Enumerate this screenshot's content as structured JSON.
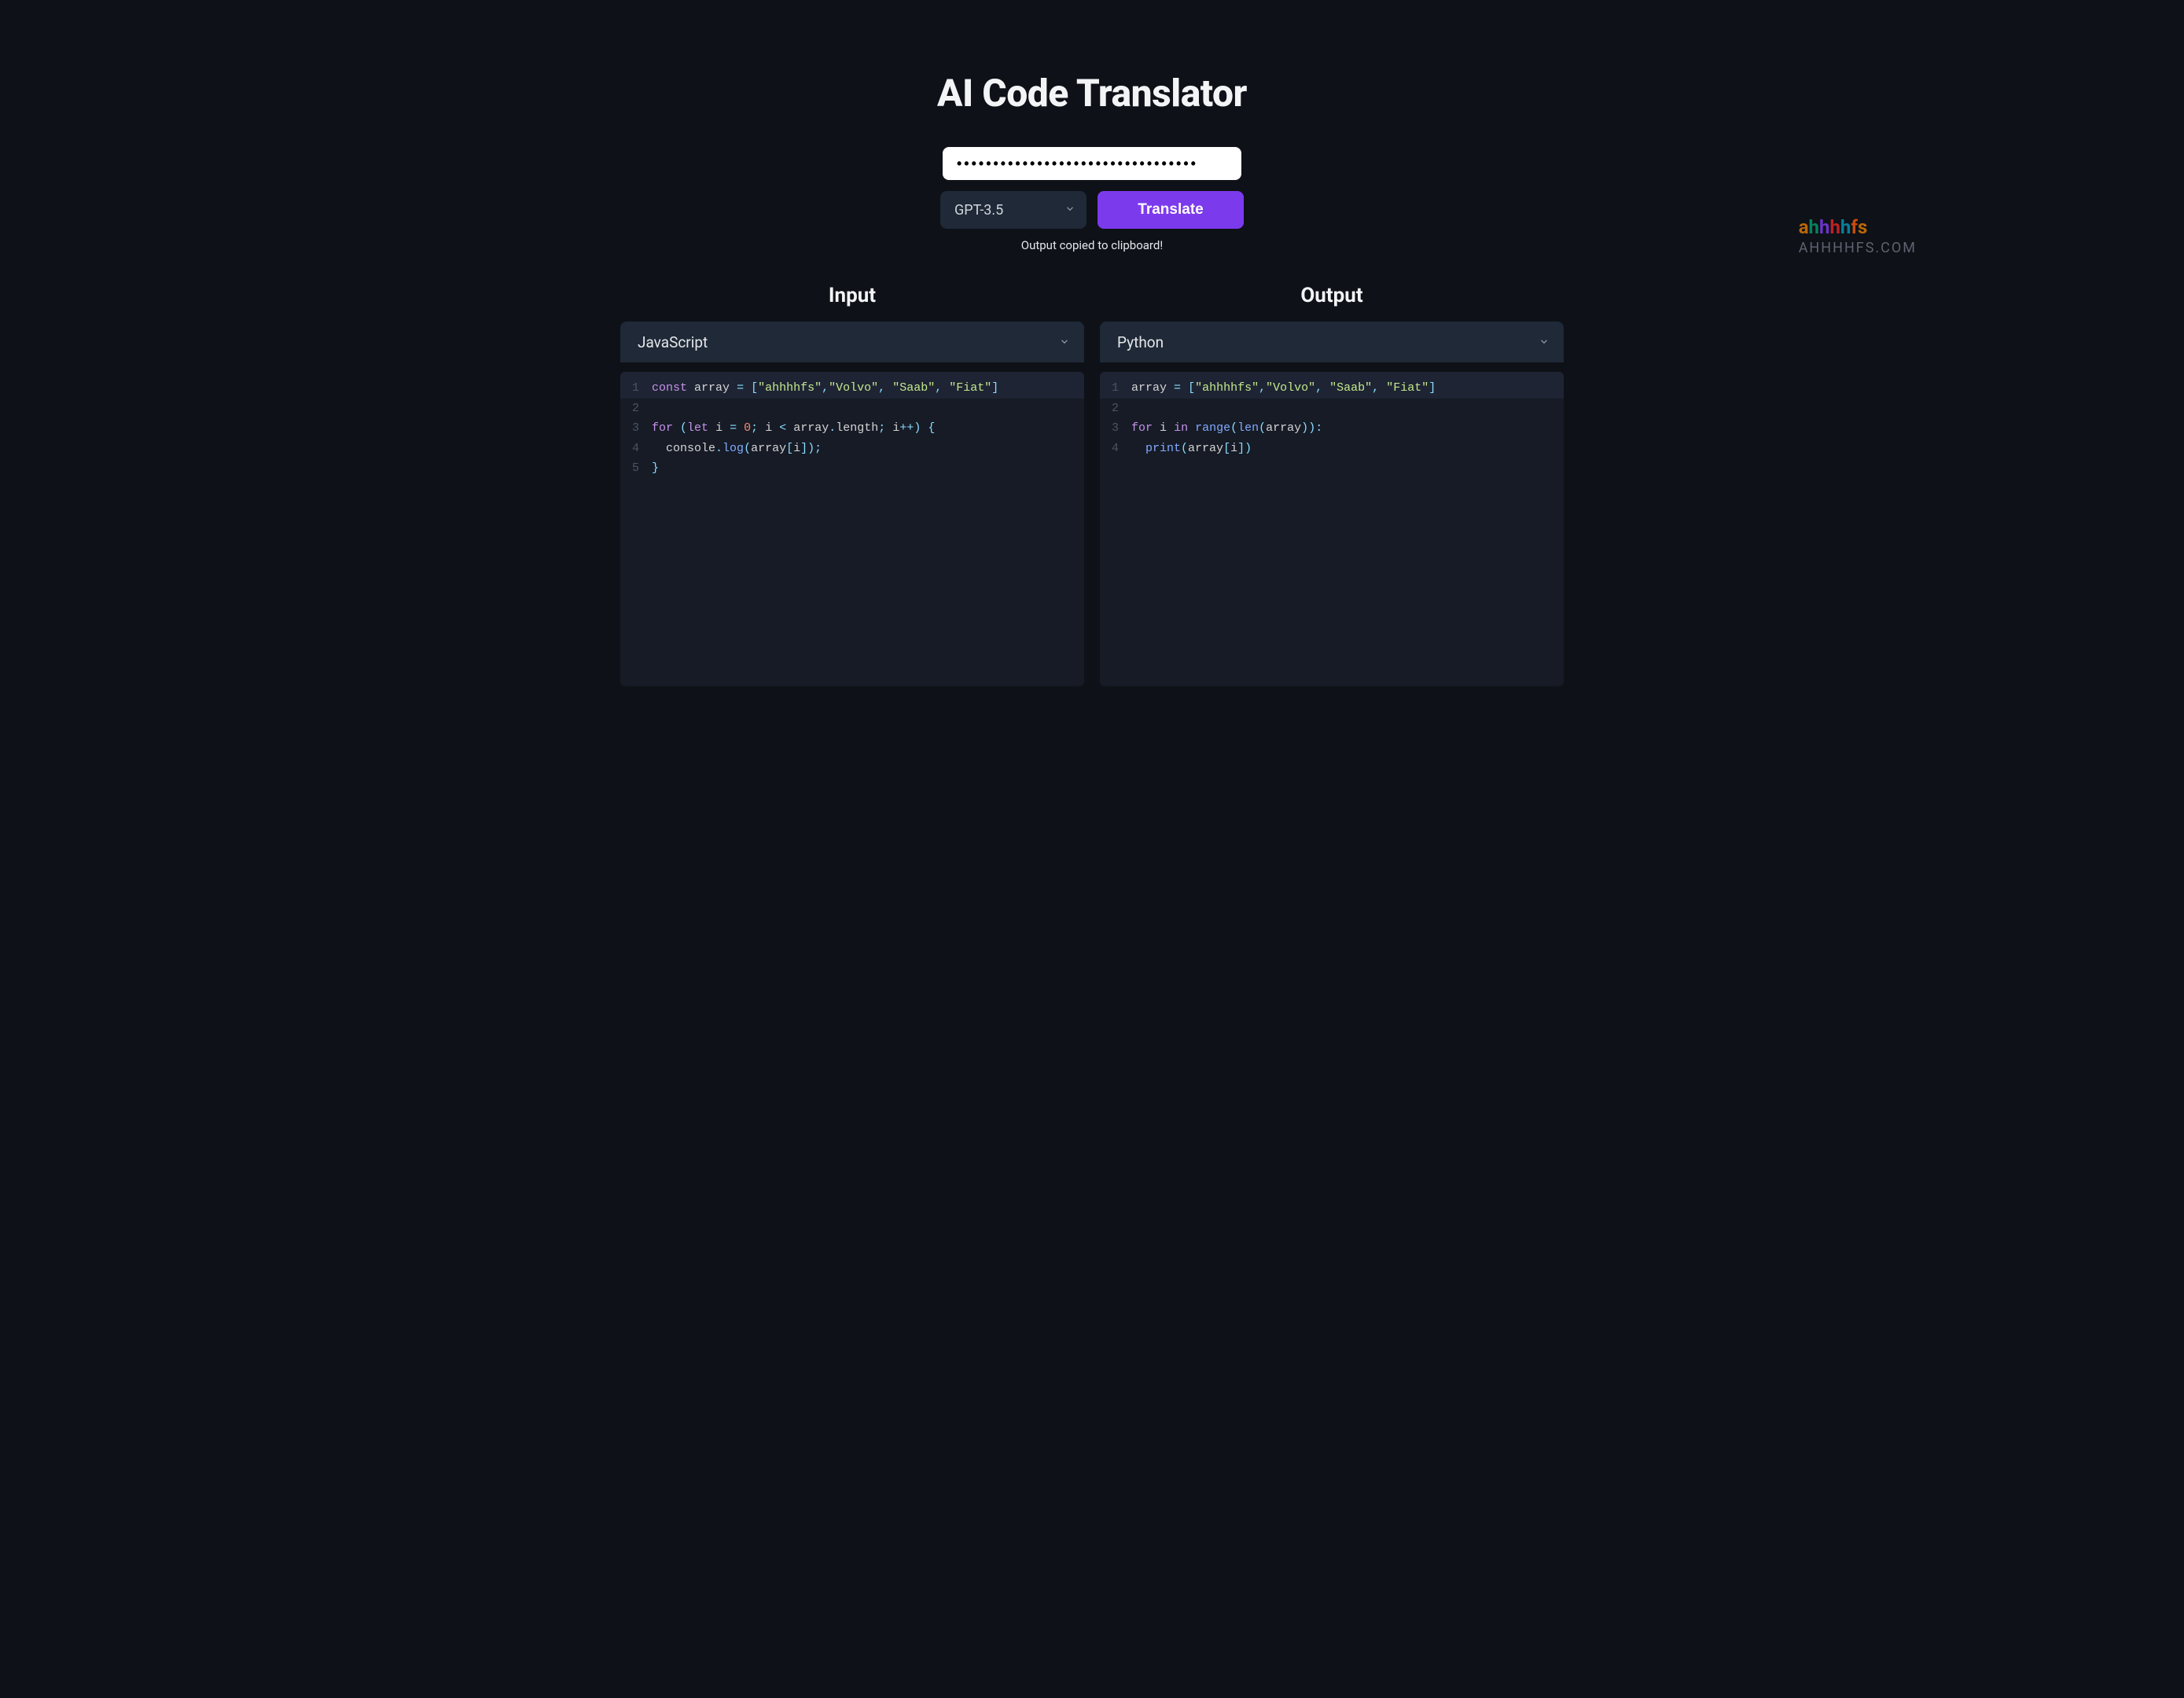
{
  "title": "AI Code Translator",
  "api_key_value": "•••••••••••••••••••••••••••••••••",
  "model_select": {
    "selected": "GPT-3.5"
  },
  "translate_button_label": "Translate",
  "status_message": "Output copied to clipboard!",
  "watermark": {
    "brand": "ahhhhfs",
    "domain": "AHHHHFS.COM"
  },
  "input_panel": {
    "title": "Input",
    "language": "JavaScript",
    "code_lines": [
      {
        "num": "1",
        "highlighted": true,
        "tokens": [
          {
            "t": "const",
            "c": "keyword"
          },
          {
            "t": " ",
            "c": "default"
          },
          {
            "t": "array",
            "c": "default"
          },
          {
            "t": " ",
            "c": "default"
          },
          {
            "t": "=",
            "c": "operator"
          },
          {
            "t": " ",
            "c": "default"
          },
          {
            "t": "[",
            "c": "punct"
          },
          {
            "t": "\"ahhhhfs\"",
            "c": "string"
          },
          {
            "t": ",",
            "c": "punct"
          },
          {
            "t": "\"Volvo\"",
            "c": "string"
          },
          {
            "t": ",",
            "c": "punct"
          },
          {
            "t": " ",
            "c": "default"
          },
          {
            "t": "\"Saab\"",
            "c": "string"
          },
          {
            "t": ",",
            "c": "punct"
          },
          {
            "t": " ",
            "c": "default"
          },
          {
            "t": "\"Fiat\"",
            "c": "string"
          },
          {
            "t": "]",
            "c": "punct"
          }
        ]
      },
      {
        "num": "2",
        "highlighted": false,
        "tokens": []
      },
      {
        "num": "3",
        "highlighted": false,
        "tokens": [
          {
            "t": "for",
            "c": "keyword"
          },
          {
            "t": " ",
            "c": "default"
          },
          {
            "t": "(",
            "c": "punct"
          },
          {
            "t": "let",
            "c": "keyword"
          },
          {
            "t": " ",
            "c": "default"
          },
          {
            "t": "i",
            "c": "default"
          },
          {
            "t": " ",
            "c": "default"
          },
          {
            "t": "=",
            "c": "operator"
          },
          {
            "t": " ",
            "c": "default"
          },
          {
            "t": "0",
            "c": "number"
          },
          {
            "t": ";",
            "c": "punct"
          },
          {
            "t": " ",
            "c": "default"
          },
          {
            "t": "i",
            "c": "default"
          },
          {
            "t": " ",
            "c": "default"
          },
          {
            "t": "<",
            "c": "operator"
          },
          {
            "t": " ",
            "c": "default"
          },
          {
            "t": "array",
            "c": "default"
          },
          {
            "t": ".",
            "c": "punct"
          },
          {
            "t": "length",
            "c": "default"
          },
          {
            "t": ";",
            "c": "punct"
          },
          {
            "t": " ",
            "c": "default"
          },
          {
            "t": "i",
            "c": "default"
          },
          {
            "t": "++",
            "c": "operator"
          },
          {
            "t": ")",
            "c": "punct"
          },
          {
            "t": " ",
            "c": "default"
          },
          {
            "t": "{",
            "c": "punct"
          }
        ]
      },
      {
        "num": "4",
        "highlighted": false,
        "tokens": [
          {
            "t": "  ",
            "c": "default"
          },
          {
            "t": "console",
            "c": "default"
          },
          {
            "t": ".",
            "c": "punct"
          },
          {
            "t": "log",
            "c": "function"
          },
          {
            "t": "(",
            "c": "punct"
          },
          {
            "t": "array",
            "c": "default"
          },
          {
            "t": "[",
            "c": "punct"
          },
          {
            "t": "i",
            "c": "default"
          },
          {
            "t": "]",
            "c": "punct"
          },
          {
            "t": ")",
            "c": "punct"
          },
          {
            "t": ";",
            "c": "punct"
          }
        ]
      },
      {
        "num": "5",
        "highlighted": false,
        "tokens": [
          {
            "t": "}",
            "c": "punct"
          }
        ]
      }
    ]
  },
  "output_panel": {
    "title": "Output",
    "language": "Python",
    "code_lines": [
      {
        "num": "1",
        "highlighted": true,
        "tokens": [
          {
            "t": "array",
            "c": "default"
          },
          {
            "t": " ",
            "c": "default"
          },
          {
            "t": "=",
            "c": "operator"
          },
          {
            "t": " ",
            "c": "default"
          },
          {
            "t": "[",
            "c": "punct"
          },
          {
            "t": "\"ahhhhfs\"",
            "c": "string"
          },
          {
            "t": ",",
            "c": "punct"
          },
          {
            "t": "\"Volvo\"",
            "c": "string"
          },
          {
            "t": ",",
            "c": "punct"
          },
          {
            "t": " ",
            "c": "default"
          },
          {
            "t": "\"Saab\"",
            "c": "string"
          },
          {
            "t": ",",
            "c": "punct"
          },
          {
            "t": " ",
            "c": "default"
          },
          {
            "t": "\"Fiat\"",
            "c": "string"
          },
          {
            "t": "]",
            "c": "punct"
          }
        ]
      },
      {
        "num": "2",
        "highlighted": false,
        "tokens": []
      },
      {
        "num": "3",
        "highlighted": false,
        "tokens": [
          {
            "t": "for",
            "c": "keyword"
          },
          {
            "t": " ",
            "c": "default"
          },
          {
            "t": "i",
            "c": "default"
          },
          {
            "t": " ",
            "c": "default"
          },
          {
            "t": "in",
            "c": "keyword"
          },
          {
            "t": " ",
            "c": "default"
          },
          {
            "t": "range",
            "c": "builtin"
          },
          {
            "t": "(",
            "c": "punct"
          },
          {
            "t": "len",
            "c": "builtin"
          },
          {
            "t": "(",
            "c": "punct"
          },
          {
            "t": "array",
            "c": "default"
          },
          {
            "t": ")",
            "c": "punct"
          },
          {
            "t": ")",
            "c": "punct"
          },
          {
            "t": ":",
            "c": "punct"
          }
        ]
      },
      {
        "num": "4",
        "highlighted": false,
        "tokens": [
          {
            "t": "  ",
            "c": "default"
          },
          {
            "t": "print",
            "c": "builtin"
          },
          {
            "t": "(",
            "c": "punct"
          },
          {
            "t": "array",
            "c": "default"
          },
          {
            "t": "[",
            "c": "punct"
          },
          {
            "t": "i",
            "c": "default"
          },
          {
            "t": "]",
            "c": "punct"
          },
          {
            "t": ")",
            "c": "punct"
          }
        ]
      }
    ]
  }
}
